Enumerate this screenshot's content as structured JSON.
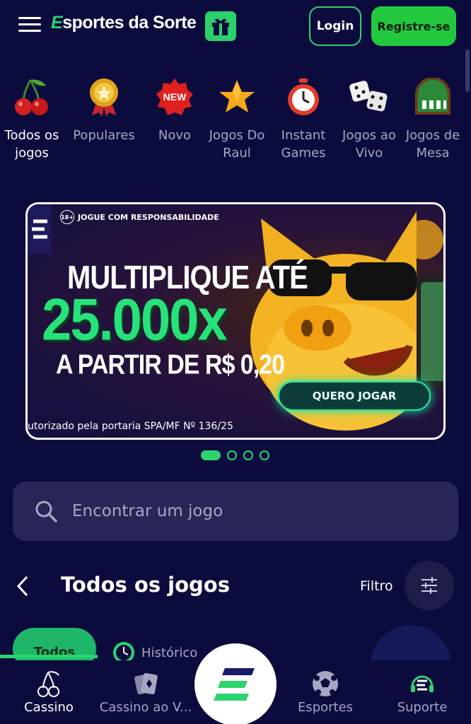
{
  "header": {
    "logo_e": "E",
    "logo_text": "sportes da Sorte",
    "login_label": "Login",
    "register_label": "Registre-se"
  },
  "categories": [
    {
      "label": "Todos os jogos",
      "icon": "cherry-icon",
      "active": true
    },
    {
      "label": "Populares",
      "icon": "medal-icon"
    },
    {
      "label": "Novo",
      "icon": "new-badge-icon"
    },
    {
      "label": "Jogos Do Raul",
      "icon": "star-icon"
    },
    {
      "label": "Instant Games",
      "icon": "stopwatch-icon"
    },
    {
      "label": "Jogos ao Vivo",
      "icon": "dice-icon"
    },
    {
      "label": "Jogos de Mesa",
      "icon": "table-icon"
    }
  ],
  "banner": {
    "responsibility": "JOGUE COM RESPONSABILIDADE",
    "age_badge": "18+",
    "line1": "MULTIPLIQUE ATÉ",
    "line2": "25.000x",
    "line3": "A PARTIR DE R$ 0,20",
    "cta": "QUERO JOGAR",
    "legal": "utorizado pela portaria SPA/MF Nº 136/25",
    "slides_total": 4,
    "active_slide": 1
  },
  "search": {
    "placeholder": "Encontrar um jogo"
  },
  "section": {
    "title": "Todos os jogos",
    "filter_label": "Filtro"
  },
  "chips": {
    "todos": "Todos",
    "historico": "Histórico"
  },
  "bottom_nav": {
    "cassino": "Cassino",
    "cassino_ao_vivo": "Cassino ao V...",
    "esportes": "Esportes",
    "suporte": "Suporte"
  },
  "colors": {
    "background": "#0c0b3d",
    "accent": "#2bd46d",
    "register": "#22c93f"
  }
}
